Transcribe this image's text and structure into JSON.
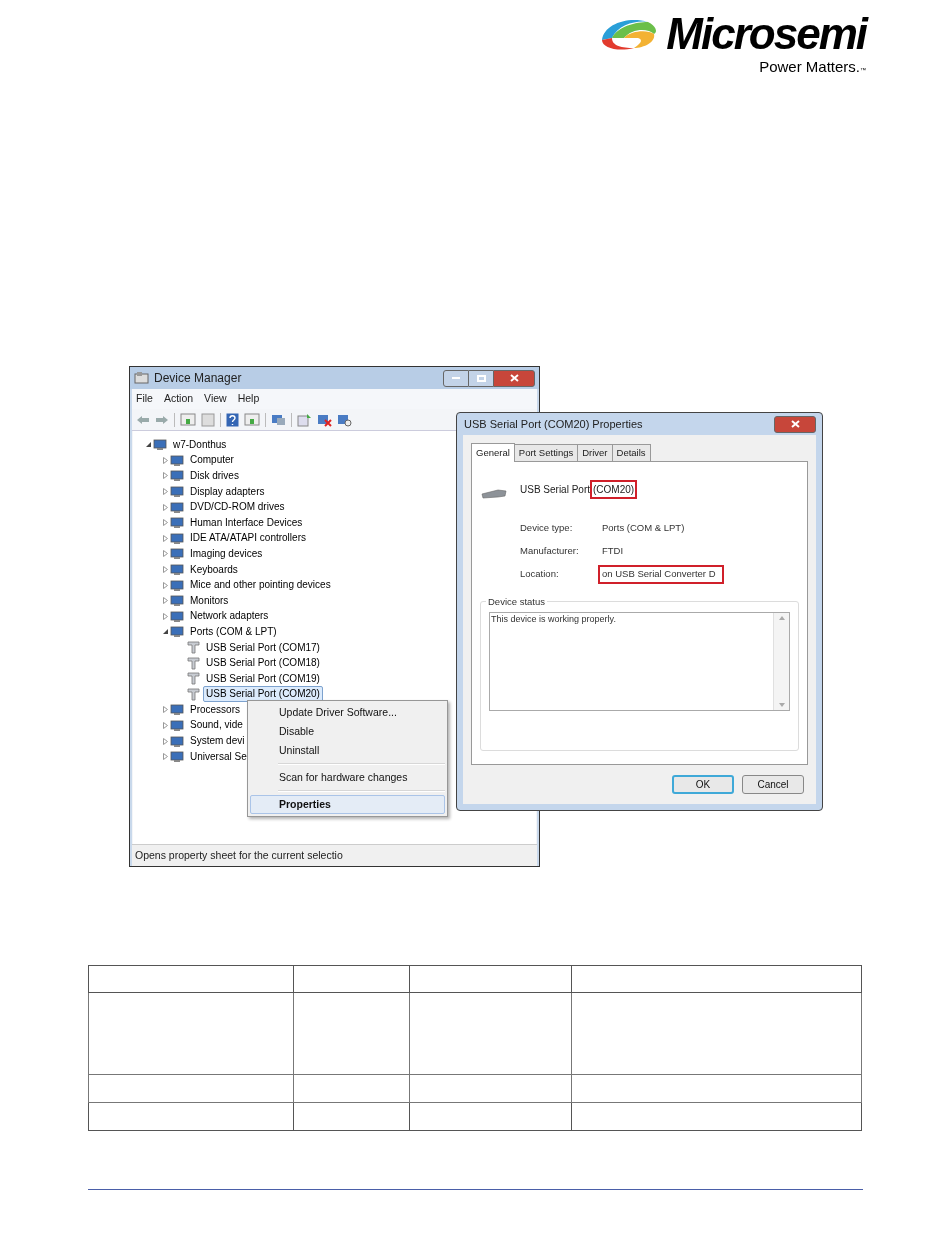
{
  "logo": {
    "name": "Microsemi",
    "tagline": "Power Matters.",
    "trademark": "™"
  },
  "device_manager": {
    "title": "Device Manager",
    "menu": [
      "File",
      "Action",
      "View",
      "Help"
    ],
    "tree": {
      "label": "w7-Donthus",
      "expanded": true,
      "children": [
        {
          "label": "Computer",
          "expanded": false
        },
        {
          "label": "Disk drives",
          "expanded": false
        },
        {
          "label": "Display adapters",
          "expanded": false
        },
        {
          "label": "DVD/CD-ROM drives",
          "expanded": false
        },
        {
          "label": "Human Interface Devices",
          "expanded": false
        },
        {
          "label": "IDE ATA/ATAPI controllers",
          "expanded": false
        },
        {
          "label": "Imaging devices",
          "expanded": false
        },
        {
          "label": "Keyboards",
          "expanded": false
        },
        {
          "label": "Mice and other pointing devices",
          "expanded": false
        },
        {
          "label": "Monitors",
          "expanded": false
        },
        {
          "label": "Network adapters",
          "expanded": false
        },
        {
          "label": "Ports (COM & LPT)",
          "expanded": true,
          "children": [
            {
              "label": "USB Serial Port (COM17)",
              "selected": false
            },
            {
              "label": "USB Serial Port (COM18)",
              "selected": false
            },
            {
              "label": "USB Serial Port (COM19)",
              "selected": false
            },
            {
              "label": "USB Serial Port (COM20)",
              "selected": true
            }
          ]
        },
        {
          "label": "Processors",
          "expanded": false
        },
        {
          "label": "Sound, vide",
          "expanded": false
        },
        {
          "label": "System devi",
          "expanded": false
        },
        {
          "label": "Universal Se",
          "expanded": false
        }
      ]
    },
    "status_bar": "Opens property sheet for the current selectio"
  },
  "context_menu": {
    "items": [
      {
        "label": "Update Driver Software...",
        "selected": false,
        "separator_before": false
      },
      {
        "label": "Disable",
        "selected": false,
        "separator_before": false
      },
      {
        "label": "Uninstall",
        "selected": false,
        "separator_before": false
      },
      {
        "label": "Scan for hardware changes",
        "selected": false,
        "separator_before": true
      },
      {
        "label": "Properties",
        "selected": true,
        "separator_before": true
      }
    ]
  },
  "properties_dialog": {
    "title": "USB Serial Port (COM20) Properties",
    "tabs": [
      {
        "label": "General",
        "selected": true
      },
      {
        "label": "Port Settings",
        "selected": false
      },
      {
        "label": "Driver",
        "selected": false
      },
      {
        "label": "Details",
        "selected": false
      }
    ],
    "device_name": "USB Serial Port",
    "device_port": {
      "text": "(COM20)",
      "highlighted": true
    },
    "fields": [
      {
        "label": "Device type:",
        "value": "Ports (COM & LPT)",
        "highlighted": false
      },
      {
        "label": "Manufacturer:",
        "value": "FTDI",
        "highlighted": false
      },
      {
        "label": "Location:",
        "value": "on USB Serial Converter D",
        "highlighted": true
      }
    ],
    "status_group": "Device status",
    "status_text": "This device is working properly.",
    "buttons": [
      {
        "label": "OK",
        "default": true
      },
      {
        "label": "Cancel",
        "default": false
      }
    ]
  }
}
